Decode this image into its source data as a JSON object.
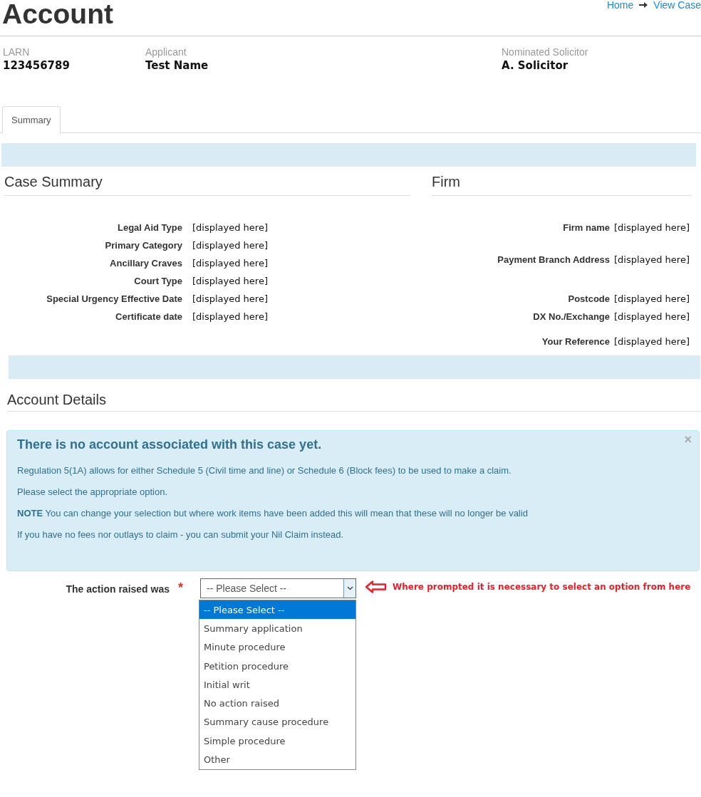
{
  "page_title": "Account",
  "breadcrumb": [
    "Home",
    "View Case"
  ],
  "header_fields": [
    {
      "label": "LARN",
      "value": "123456789"
    },
    {
      "label": "Applicant",
      "value": "Test Name"
    },
    {
      "label": "Nominated Solicitor",
      "value": "A. Solicitor"
    }
  ],
  "tabs": [
    {
      "label": "Summary",
      "selected": true
    }
  ],
  "case_summary": {
    "title": "Case Summary",
    "rows": [
      {
        "label": "Legal Aid Type",
        "value": "[displayed here]"
      },
      {
        "label": "Primary Category",
        "value": "[displayed here]"
      },
      {
        "label": "Ancillary Craves",
        "value": "[displayed here]"
      },
      {
        "label": "Court Type",
        "value": "[displayed here]"
      },
      {
        "label": "Special Urgency Effective Date",
        "value": "[displayed here]"
      },
      {
        "label": "Certificate date",
        "value": "[displayed here]"
      }
    ]
  },
  "firm": {
    "title": "Firm",
    "rows": [
      {
        "label": "Firm name",
        "value": "[displayed here]"
      },
      {
        "label": "Payment Branch Address",
        "value": "[displayed here]"
      },
      {
        "label": "Postcode",
        "value": "[displayed here]"
      },
      {
        "label": "DX No./Exchange",
        "value": "[displayed here]"
      },
      {
        "label": "Your Reference",
        "value": "[displayed here]"
      }
    ]
  },
  "account_details": {
    "title": "Account Details",
    "alert": {
      "title": "There is no account associated with this case yet.",
      "close": "×",
      "paragraphs": [
        "Regulation 5(1A) allows for either Schedule 5 (Civil time and line) or Schedule 6 (Block fees) to be used to make a claim.",
        "Please select the appropriate option.",
        "**NOTE** You can change your selection but where work items have been added this will mean that these will no longer be valid",
        "If you have no fees nor outlays to claim - you can submit your Nil Claim instead."
      ]
    },
    "field": {
      "label": "The action raised was",
      "required": "*",
      "value": "-- Please Select --",
      "expanded": true,
      "options": [
        {
          "label": "-- Please Select --",
          "selected": true
        },
        {
          "label": "Summary application",
          "selected": false
        },
        {
          "label": "Minute procedure",
          "selected": false
        },
        {
          "label": "Petition procedure",
          "selected": false
        },
        {
          "label": "Initial writ",
          "selected": false
        },
        {
          "label": "No action raised",
          "selected": false
        },
        {
          "label": "Summary cause procedure",
          "selected": false
        },
        {
          "label": "Simple procedure",
          "selected": false
        },
        {
          "label": "Other",
          "selected": false
        }
      ]
    },
    "annotation": "Where prompted it is necessary to select an option from here"
  }
}
